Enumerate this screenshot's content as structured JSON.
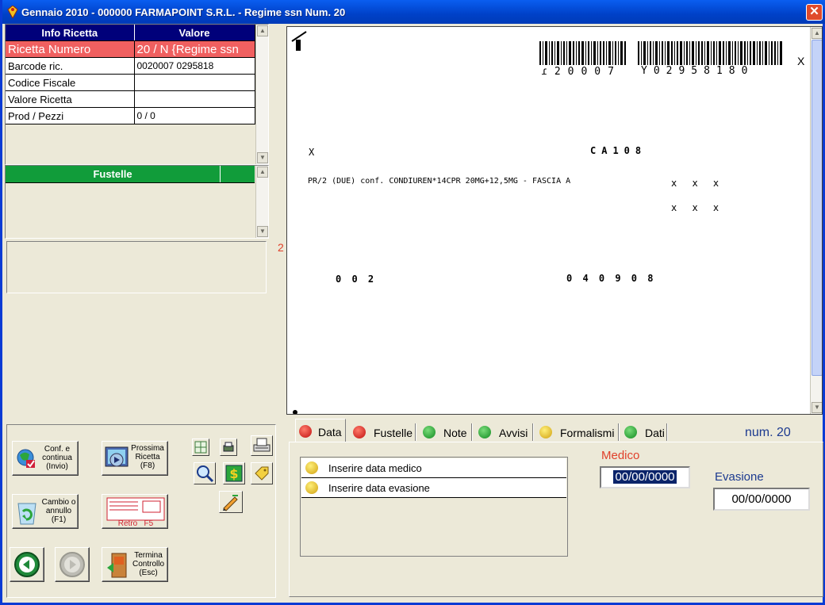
{
  "window": {
    "title": "Gennaio 2010 - 000000 FARMAPOINT S.R.L. - Regime ssn Num. 20",
    "close_glyph": "✕"
  },
  "info_table": {
    "headers": [
      "Info Ricetta",
      "Valore"
    ],
    "rows": [
      {
        "label": "Ricetta Numero",
        "value": "20 / N {Regime ssn"
      },
      {
        "label": "Barcode ric.",
        "value": "0020007 0295818"
      },
      {
        "label": "Codice Fiscale",
        "value": ""
      },
      {
        "label": "Valore Ricetta",
        "value": ""
      },
      {
        "label": "Prod / Pezzi",
        "value": "0 / 0"
      }
    ],
    "selected_row_color": "#f06060",
    "header_color": "#00007a"
  },
  "fustelle_table": {
    "header": "Fustelle",
    "header_color": "#119c3a"
  },
  "side_marker": "2",
  "prescription": {
    "barcode_left_text": "ɾ20007",
    "barcode_right_text": "Y02958180",
    "top_right_mark": "X",
    "line_x": "X",
    "code": "CA108",
    "drug_line": "PR/2 (DUE) conf. CONDIUREN*14CPR 20MG+12,5MG - FASCIA A",
    "marks_row1": "x x x",
    "marks_row2": "x x x",
    "qty": "0 0 2",
    "date": "0 4 0 9 0 8"
  },
  "buttons": {
    "conf_continua": "Conf. e continua (Invio)",
    "prossima_ricetta": "Prossima Ricetta (F8)",
    "cambio_annullo": "Cambio o annullo (F1)",
    "retro": "Retro   F5",
    "termina_controllo": "Termina Controllo (Esc)"
  },
  "tabs": [
    {
      "label": "Data",
      "status": "red"
    },
    {
      "label": "Fustelle",
      "status": "red"
    },
    {
      "label": "Note",
      "status": "green"
    },
    {
      "label": "Avvisi",
      "status": "green"
    },
    {
      "label": "Formalismi",
      "status": "yellow"
    },
    {
      "label": "Dati",
      "status": "green"
    }
  ],
  "num_label": "num. 20",
  "messages": [
    {
      "text": "Inserire data medico",
      "icon": "yellow-face-icon"
    },
    {
      "text": "Inserire data evasione",
      "icon": "yellow-face-icon"
    }
  ],
  "medico": {
    "label": "Medico",
    "value": "00/00/0000",
    "label_color": "#e0402a"
  },
  "evasione": {
    "label": "Evasione",
    "value": "00/00/0000"
  }
}
